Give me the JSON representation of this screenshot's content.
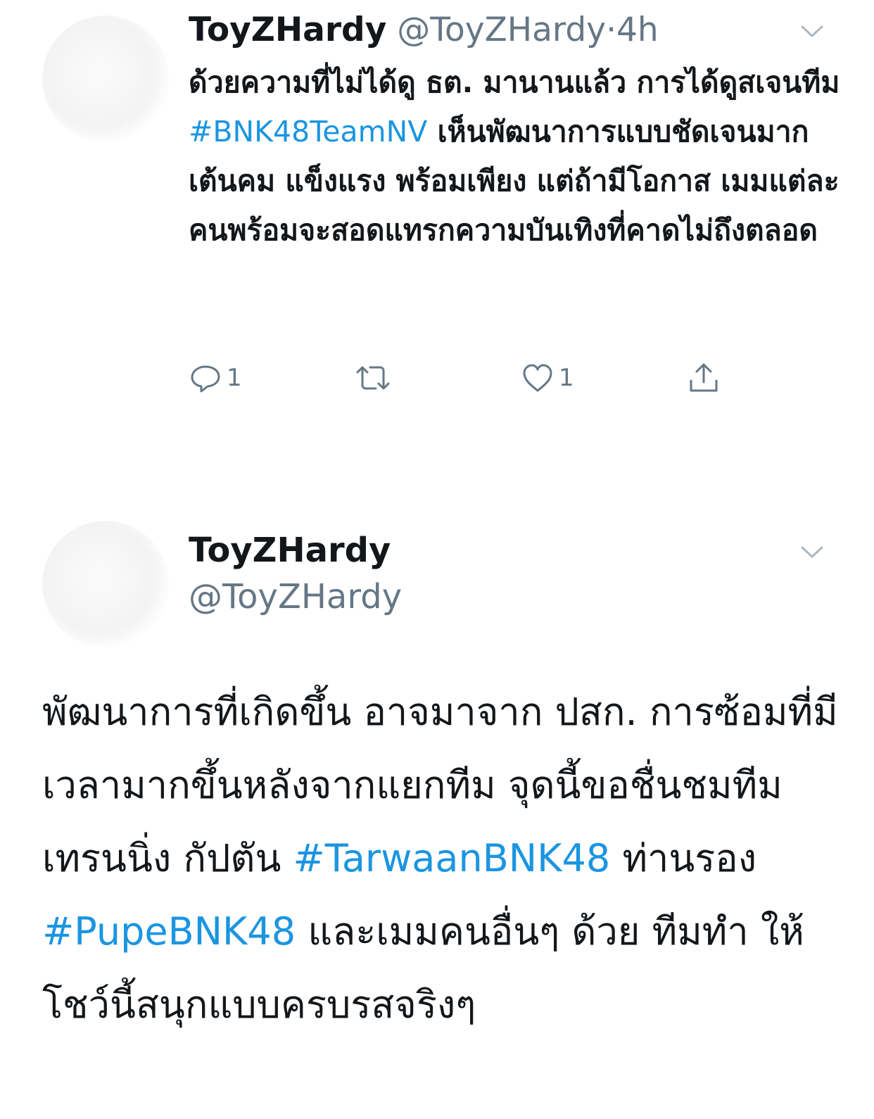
{
  "tweet1": {
    "name": "ToyZHardy",
    "handle": "@ToyZHardy",
    "separator": "·",
    "time": "4h",
    "text_1": "ด้วยความที่ไม่ได้ดู ธต. มานานแล้ว การได้ดูสเจนทีม ",
    "hashtag": "#BNK48TeamNV",
    "text_2": " เห็นพัฒนาการแบบชัดเจนมาก เต้นคม แข็งแรง พร้อมเพียง แต่ถ้ามีโอกาส เมมแต่ละคนพร้อมจะสอดแทรกความบันเทิงที่คาดไม่ถึงตลอด",
    "reply_count": "1",
    "like_count": "1",
    "icons": [
      "avatar",
      "chevron-down-icon",
      "reply-icon",
      "retweet-icon",
      "like-icon",
      "share-icon"
    ]
  },
  "tweet2": {
    "name": "ToyZHardy",
    "handle": "@ToyZHardy",
    "text_1": "พัฒนาการที่เกิดขึ้น อาจมาจาก ปสก. การซ้อมที่มีเวลามากขึ้นหลังจากแยกทีม จุดนี้ขอชื่นชมทีมเทรนนิ่ง กัปตัน ",
    "hashtag_1": "#TarwaanBNK48",
    "text_2": " ท่านรอง ",
    "hashtag_2": "#PupeBNK48",
    "text_3": " และเมมคนอื่นๆ ด้วย ทีมทำ ให้โชว์นี้สนุกแบบครบรสจริงๆ"
  },
  "colors": {
    "text": "#14171a",
    "secondary": "#657786",
    "link": "#1b95e0",
    "background": "#ffffff"
  }
}
